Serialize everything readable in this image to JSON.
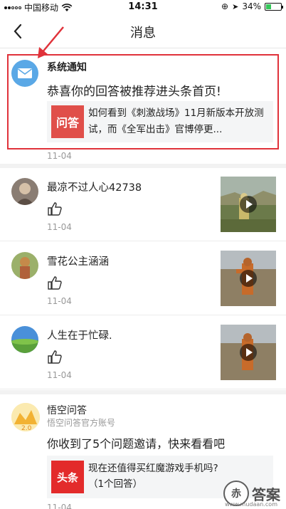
{
  "status_bar": {
    "carrier": "中国移动",
    "time": "14:31",
    "battery": "34%",
    "battery_level": 0.34
  },
  "nav": {
    "title": "消息"
  },
  "system_notice": {
    "sender": "系统通知",
    "text": "恭喜你的回答被推荐进头条首页!",
    "card_badge": "问答",
    "card_text": "如何看到《刺激战场》11月新版本开放测试，而《全军出击》官博停更...",
    "date": "11-04"
  },
  "likes": [
    {
      "name": "最凉不过人心42738",
      "date": "11-04"
    },
    {
      "name": "雪花公主涵涵",
      "date": "11-04"
    },
    {
      "name": "人生在于忙碌.",
      "date": "11-04"
    }
  ],
  "invitation": {
    "name": "悟空问答",
    "subtitle": "悟空问答官方账号",
    "text": "你收到了5个问题邀请，快来看看吧",
    "card_badge": "头条",
    "card_text": "现在还值得买红魔游戏手机吗?（1个回答）",
    "date": "11-04"
  },
  "watermark": {
    "text": "答案",
    "url": "www.mudaan.com"
  },
  "colors": {
    "highlight_border": "#e0323a",
    "mail_avatar": "#5aa8e6",
    "date_gray": "#999999"
  }
}
